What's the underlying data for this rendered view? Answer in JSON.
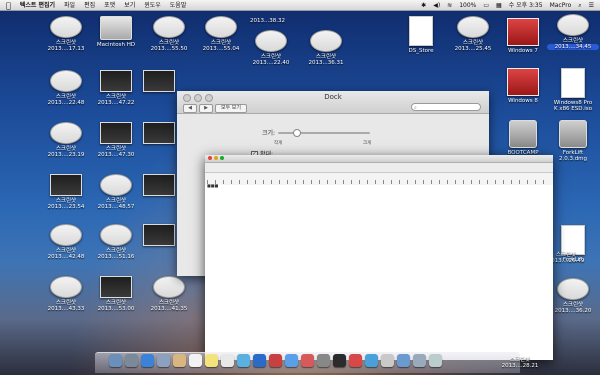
{
  "menubar": {
    "apple": "",
    "app_name": "텍스트 편집기",
    "menus": [
      "파일",
      "편집",
      "포맷",
      "보기",
      "윈도우",
      "도움말"
    ],
    "battery": "100%",
    "clock": "수 오후 3:35",
    "user": "MacPro"
  },
  "desktop_icons": [
    {
      "line1": "스크린샷",
      "line2": "2013....17.13"
    },
    {
      "line1": "",
      "line2": "Macintosh HD"
    },
    {
      "line1": "스크린샷",
      "line2": "2013....55.50"
    },
    {
      "line1": "스크린샷",
      "line2": "2013....55.04"
    },
    {
      "line1": "스크린샷",
      "line2": "2013....22.40"
    },
    {
      "line1": "스크린샷",
      "line2": "2013...38.32"
    },
    {
      "line1": "스크린샷",
      "line2": "2013...36.31"
    },
    {
      "line1": "",
      "line2": "DS_Store"
    },
    {
      "line1": "스크린샷",
      "line2": "2013....25.45"
    },
    {
      "line1": "",
      "line2": "Windows 7"
    },
    {
      "line1": "스크린샷",
      "line2": "2013....34.45"
    },
    {
      "line1": "스크린샷",
      "line2": "2013....22.48"
    },
    {
      "line1": "스크린샷",
      "line2": "2013....47.22"
    },
    {
      "line1": "",
      "line2": "Windows 8"
    },
    {
      "line1": "Windows8 Pro",
      "line2": "K x86 ESD.iso"
    },
    {
      "line1": "스크린샷",
      "line2": "2013....23.19"
    },
    {
      "line1": "스크린샷",
      "line2": "2013....47.30"
    },
    {
      "line1": "",
      "line2": "BOOTCAMP"
    },
    {
      "line1": "ForkLift",
      "line2": "2.0.3.dmg"
    },
    {
      "line1": "스크린샷",
      "line2": "2013....23.54"
    },
    {
      "line1": "스크린샷",
      "line2": "2013....48.57"
    },
    {
      "line1": "스크린샷",
      "line2": "2013....42.48"
    },
    {
      "line1": "스크린샷",
      "line2": "2013....51.16"
    },
    {
      "line1": "ForkLift",
      "line2": ""
    },
    {
      "line1": "스크린샷",
      "line2": "2013....26.49"
    },
    {
      "line1": "스크린샷",
      "line2": "2013....43.33"
    },
    {
      "line1": "스크린샷",
      "line2": "2013....53.00"
    },
    {
      "line1": "스크린샷",
      "line2": "2013....41.35"
    },
    {
      "line1": "스크린샷",
      "line2": "2013....36.20"
    },
    {
      "line1": "스크린샷",
      "line2": "2013....28.21"
    }
  ],
  "dock_prefs": {
    "title": "Dock",
    "show_all": "모두 보기",
    "size_label": "크기:",
    "size_small": "작게",
    "size_large": "크게",
    "magnify_label": "확대:",
    "size_level": 0.2
  },
  "textedit": {
    "body_text": "■■■"
  }
}
